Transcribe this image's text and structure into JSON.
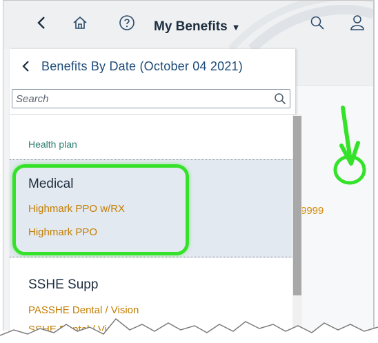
{
  "shellbar": {
    "title": "My Benefits",
    "icons": [
      "back-icon",
      "home-icon",
      "help-icon",
      "caret-down-icon",
      "search-icon",
      "user-icon"
    ]
  },
  "panel": {
    "title": "Benefits By Date (October 04 2021)",
    "search": {
      "placeholder": "Search",
      "value": ""
    },
    "group_label": "Health plan",
    "selected_item": {
      "title": "Medical",
      "plans": [
        "Highmark PPO w/RX",
        "Highmark PPO"
      ]
    },
    "next_item": {
      "title": "SSHE Supp",
      "plans": [
        "PASSHE Dental / Vision",
        "SSHE Dental / Vision"
      ]
    }
  },
  "content": {
    "partial_number": "9999"
  },
  "colors": {
    "highlight": "#35e22a",
    "accent_text": "#c47d00",
    "group_label": "#2e7d6e",
    "title_blue": "#1d4a78"
  }
}
